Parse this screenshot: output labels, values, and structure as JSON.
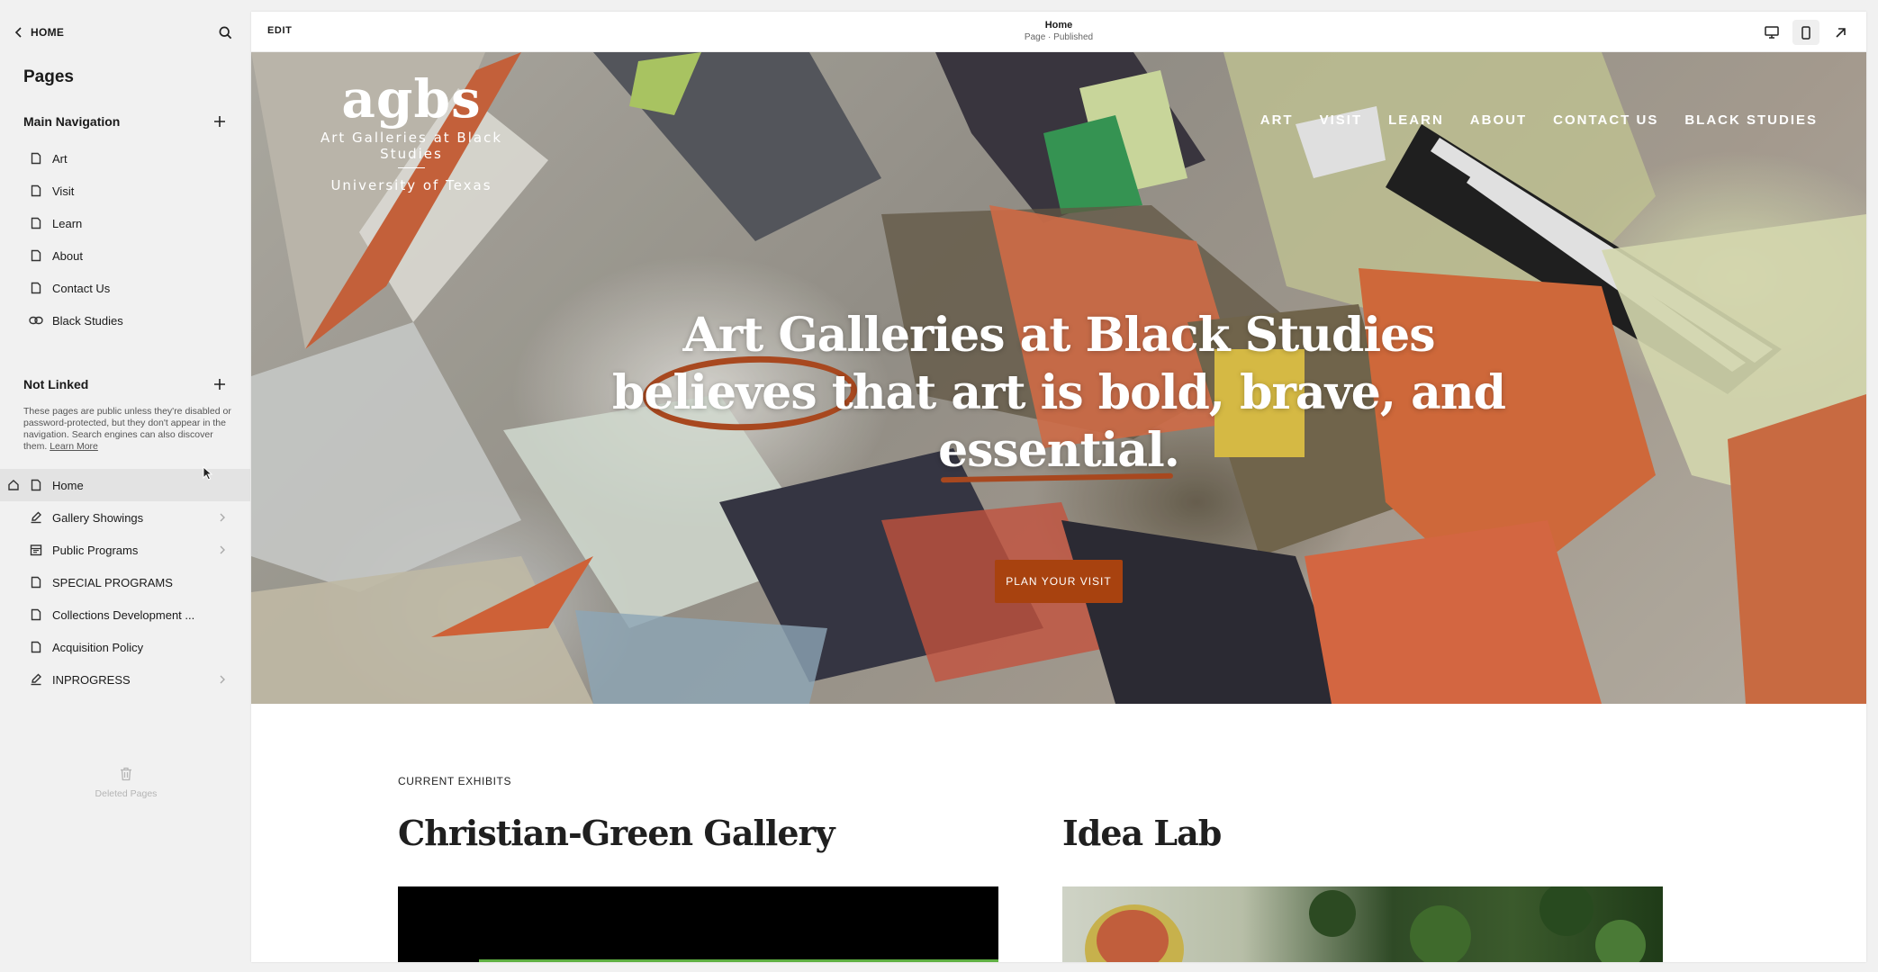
{
  "sidebar": {
    "back_label": "HOME",
    "title": "Pages",
    "main_navigation": {
      "heading": "Main Navigation",
      "items": [
        {
          "label": "Art",
          "icon": "page-icon"
        },
        {
          "label": "Visit",
          "icon": "page-icon"
        },
        {
          "label": "Learn",
          "icon": "page-icon"
        },
        {
          "label": "About",
          "icon": "page-icon"
        },
        {
          "label": "Contact Us",
          "icon": "page-icon"
        },
        {
          "label": "Black Studies",
          "icon": "link-icon"
        }
      ]
    },
    "not_linked": {
      "heading": "Not Linked",
      "description": "These pages are public unless they're disabled or password-protected, but they don't appear in the navigation. Search engines can also discover them.",
      "learn_more": "Learn More",
      "items": [
        {
          "label": "Home",
          "icon": "page-icon",
          "active": true,
          "homepage": true
        },
        {
          "label": "Gallery Showings",
          "icon": "blog-icon",
          "chevron": true
        },
        {
          "label": "Public Programs",
          "icon": "events-icon",
          "chevron": true
        },
        {
          "label": "SPECIAL PROGRAMS",
          "icon": "page-icon"
        },
        {
          "label": "Collections Development ...",
          "icon": "page-icon"
        },
        {
          "label": "Acquisition Policy",
          "icon": "page-icon"
        },
        {
          "label": "INPROGRESS",
          "icon": "blog-icon",
          "chevron": true
        }
      ]
    },
    "deleted_pages": "Deleted Pages"
  },
  "toolbar": {
    "edit": "EDIT",
    "page_name": "Home",
    "page_status": "Page · Published"
  },
  "hero": {
    "logo_mark": "agbs",
    "logo_line1": "Art Galleries at Black Studies",
    "logo_line2": "University of Texas",
    "nav": [
      "ART",
      "VISIT",
      "LEARN",
      "ABOUT",
      "CONTACT US",
      "BLACK STUDIES"
    ],
    "headline_line1": "Art Galleries at Black Studies",
    "headline_line2": "believes that art is bold, brave, and",
    "headline_line3": "essential.",
    "cta": "PLAN YOUR VISIT"
  },
  "exhibits": {
    "label": "CURRENT EXHIBITS",
    "items": [
      {
        "title": "Christian-Green Gallery"
      },
      {
        "title": "Idea Lab"
      }
    ]
  },
  "colors": {
    "accent": "#a8420f",
    "sidebar_bg": "#f1f1f1",
    "active_row": "#e3e3e3"
  }
}
